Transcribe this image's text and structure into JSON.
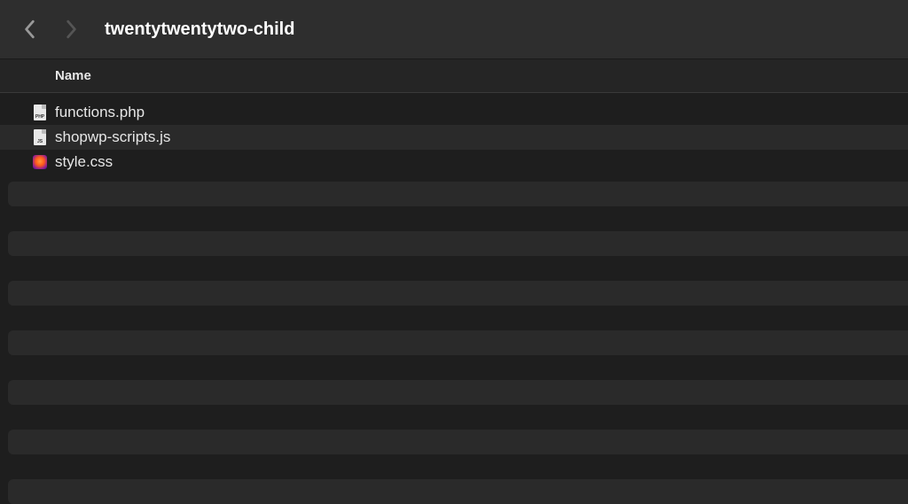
{
  "toolbar": {
    "folder_title": "twentytwentytwo-child"
  },
  "columns": {
    "name": "Name"
  },
  "files": [
    {
      "name": "functions.php",
      "icon": "php-file-icon",
      "badge": "PHP"
    },
    {
      "name": "shopwp-scripts.js",
      "icon": "js-file-icon",
      "badge": "JS"
    },
    {
      "name": "style.css",
      "icon": "css-file-icon",
      "badge": ""
    }
  ]
}
